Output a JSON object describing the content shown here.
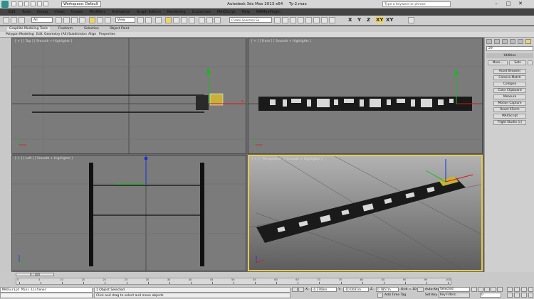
{
  "app": {
    "title": "Autodesk 3ds Max  2013 x64",
    "file": "Ty-2.max",
    "workspace": "Workspace: Default",
    "search_placeholder": "Type a keyword or phrase",
    "window_buttons": [
      "–",
      "□",
      "✕"
    ]
  },
  "menu": [
    "Edit",
    "Tools",
    "Group",
    "Views",
    "Create",
    "Modifiers",
    "Animation",
    "Graph Editors",
    "Rendering",
    "Customize",
    "MAXScript",
    "Help",
    "RWMaxPlugin"
  ],
  "toolbar": {
    "selection_filter": "All",
    "ref_coord": "View",
    "named_selection_placeholder": "Create Selection Se",
    "axis_labels": [
      "X",
      "Y",
      "Z",
      "XY",
      "XY"
    ]
  },
  "ribbon": {
    "tabs": [
      "Graphite Modeling Tools",
      "Freeform",
      "Selection",
      "Object Paint"
    ],
    "subtabs": [
      "Polygon Modeling",
      "Edit",
      "Geometry (All)",
      "Subdivision",
      "Align",
      "Properties"
    ]
  },
  "viewports": {
    "top": "[ + ] [ Top ] [ Smooth + Highlights ]",
    "front": "[ + ] [ Front ] [ Smooth + Highlights ]",
    "left": "[ + ] [ Left ] [ Smooth + Highlights ]",
    "perspective": "[ + ] [ Perspective ] [ Smooth + Highlights ]"
  },
  "command_panel": {
    "filter_value": "29",
    "header": "Utilities",
    "more_label": "More...",
    "sets_label": "Sets",
    "utilities": [
      "Asset Browser",
      "Camera Match",
      "Collapse",
      "Color Clipboard",
      "Measure",
      "Motion Capture",
      "Reset XForm",
      "MAXScript",
      "Flight Studio (c)"
    ]
  },
  "timeline": {
    "frame_slider": "0 / 100",
    "ticks": [
      "0",
      "5",
      "10",
      "15",
      "20",
      "25",
      "30",
      "35",
      "40",
      "45",
      "50",
      "55",
      "60",
      "65",
      "70",
      "75",
      "80",
      "85",
      "90",
      "95",
      "100"
    ]
  },
  "status": {
    "listener": "MAXScript Mini Listener",
    "selected": "1 Object Selected",
    "prompt": "Click and drag to select and move objects",
    "x_label": "X:",
    "x_value": "-0.2766m",
    "y_label": "Y:",
    "y_value": "-10.0041m",
    "z_label": "Z:",
    "z_value": "0.7857m",
    "grid": "Grid = 10.0m",
    "add_time_tag": "Add Time Tag",
    "auto_key": "Auto Key",
    "auto_key_value": "Selected",
    "set_key": "Set Key",
    "key_filters": "Key Filters...",
    "frame_value": "0"
  },
  "colors": {
    "viewport_bg": "#7b7b7b",
    "active_border": "#e8c84a",
    "gizmo_x": "#e01010",
    "gizmo_y": "#10c010",
    "gizmo_z": "#1030e0",
    "selected_box": "#c6b23a"
  }
}
